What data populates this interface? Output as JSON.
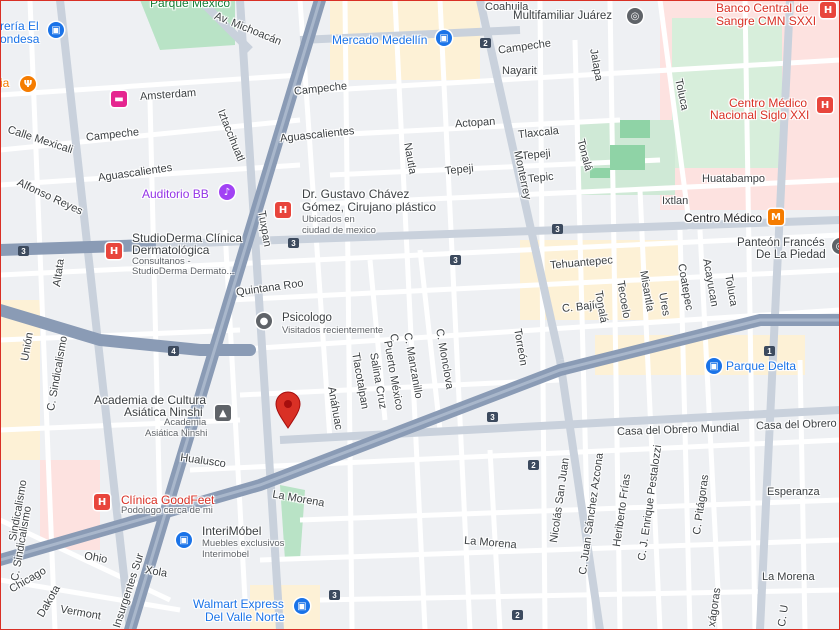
{
  "colors": {
    "background": "#eef0f3",
    "block": "#e4e7ec",
    "street": "#ffffff",
    "avenue": "#c9d1dc",
    "highway": "#8a9bb5",
    "park": "#b9e3c6",
    "commercial": "#fdf1d6",
    "medical": "#fde2e0",
    "pin": "#d93025",
    "poi_blue": "#1a73e8",
    "poi_red": "#e8453c",
    "poi_orange": "#f57c00",
    "poi_pink": "#e5258f",
    "poi_purple": "#a142f4",
    "poi_gray": "#5f6368"
  },
  "streets": {
    "coahuila": "Coahuila",
    "campeche_n": "Campeche",
    "nayarit": "Nayarit",
    "campeche_w": "Campeche",
    "campeche_mid": "Campeche",
    "av_michoacan": "Av. Michoacán",
    "amsterdam": "Amsterdam",
    "iztaccihuatl": "Iztaccihuatl",
    "aguascalientes_mid": "Aguascalientes",
    "aguascalientes_w": "Aguascalientes",
    "calle_mexicali": "Calle Mexicali",
    "alfonso_reyes": "Alfonso Reyes",
    "actopan": "Actopan",
    "tlaxcala": "Tlaxcala",
    "tepeji_1": "Tepeji",
    "tepeji_2": "Tepeji",
    "tepic": "Tepic",
    "jalapa": "Jalapa",
    "tonala_n": "Tonalá",
    "monterrey": "Monterrey",
    "nautla": "Nautla",
    "toluca_n": "Toluca",
    "ixtlan": "Ixtlan",
    "huatabampo": "Huatabampo",
    "tuxpan": "Tuxpan",
    "tehuantepec": "Tehuantepec",
    "quintana_roo": "Quintana Roo",
    "altata": "Altata",
    "union": "Unión",
    "c_sindicalismo": "C. Sindicalismo",
    "sindicalismo_2": "Sindicalismo",
    "c_sindicalismo_2": "C. Sindicalismo",
    "c_bajio": "C. Bajío",
    "tonala_s": "Tonalá",
    "tecoelo": "Tecoelo",
    "misantla": "Misantla",
    "coatepec": "Coatepec",
    "ures": "Ures",
    "acayucan": "Acayucan",
    "toluca_s": "Toluca",
    "torreon": "Torreón",
    "c_monclova": "C. Monclova",
    "c_manzanillo": "C. Manzanillo",
    "puerto_mexico": "Puerto México",
    "salina_cruz": "Salina Cruz",
    "tlacotalpan": "Tlacotalpan",
    "anahuac": "Anáhuac",
    "hualusco": "Hualusco",
    "la_morena_w": "La Morena",
    "la_morena_mid": "La Morena",
    "la_morena_e": "La Morena",
    "casa_obrero_1": "Casa del Obrero Mundial",
    "casa_obrero_2": "Casa del Obrero",
    "esperanza": "Esperanza",
    "nicolas_san_juan": "Nicolás San Juan",
    "c_juan_sanchez_azcona": "C. Juan Sánchez Azcona",
    "heriberto_frias": "Heriberto Frías",
    "c_j_enrique_pestalozzi": "C. J. Enrique Pestalozzi",
    "c_pitagoras": "C. Pitágoras",
    "xagoras": "xágoras",
    "ohio": "Ohio",
    "xola": "Xola",
    "chicago": "Chicago",
    "dakota": "Dakota",
    "vermont": "Vermont",
    "insurgentes_sur": "Insurgentes Sur",
    "calle_c": "C.",
    "c_u": "C. U"
  },
  "places": {
    "parque_mexico": "Parque México",
    "multifamiliar": "Multifamiliar Juárez",
    "banco_line1": "Banco Central de",
    "banco_line2": "Sangre CMN SXXI",
    "mercado": "Mercado Medellín",
    "centro_medico_line1": "Centro Médico",
    "centro_medico_line2": "Nacional Siglo XXI",
    "centro_medico_metro": "Centro Médico",
    "panteon_line1": "Panteón Francés",
    "panteon_line2": "De La Piedad",
    "parque_delta": "Parque Delta",
    "auditorio": "Auditorio BB",
    "gustavo_line1": "Dr. Gustavo Chávez",
    "gustavo_line2": "Gómez, Cirujano plástico",
    "gustavo_sub1": "Ubicados en",
    "gustavo_sub2": "ciudad de mexico",
    "studioderma_line1": "StudioDerma Clínica",
    "studioderma_line2": "Dermatológica",
    "studioderma_sub1": "Consultanos -",
    "studioderma_sub2": "StudioDerma Dermato...",
    "psicologo": "Psicologo",
    "psicologo_sub": "Visitados recientemente",
    "academia_line1": "Academia de Cultura",
    "academia_line2": "Asiática Ninshi",
    "academia_sub1": "Academia",
    "academia_sub2": "Asiática Ninshi",
    "goodfeet": "Clínica GoodFeet",
    "goodfeet_sub": "Podologo cerca de mi",
    "interimobel": "InteriMóbel",
    "interimobel_sub1": "Muebles exclusivos",
    "interimobel_sub2": "Interimobel",
    "walmart_line1": "Walmart Express",
    "walmart_line2": "Del Valle Norte",
    "floreria_line1": "rería El",
    "floreria_line2": "ondesa",
    "restaurant_partial": "ia"
  },
  "icons": {
    "hospital": "H",
    "shopping": "bag-icon",
    "school": "cap-icon",
    "metro": "M"
  },
  "shields": {
    "s1": "3",
    "s2": "3",
    "s3": "3",
    "s4": "4",
    "s5": "3",
    "s6": "1",
    "s7": "2",
    "s8": "2",
    "s9": "3",
    "s10": "3",
    "s11": "2"
  }
}
